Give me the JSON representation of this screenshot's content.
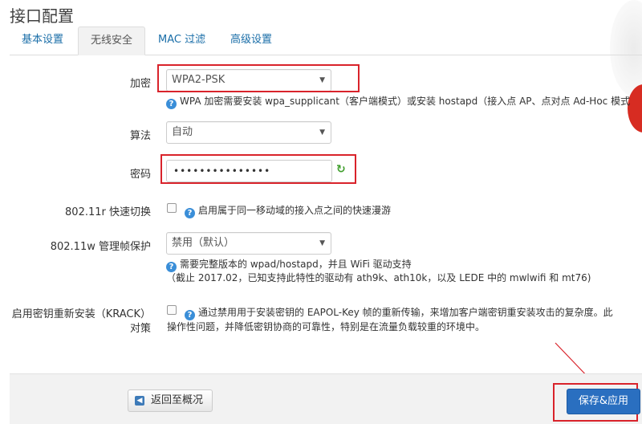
{
  "page": {
    "title": "接口配置"
  },
  "tabs": [
    {
      "label": "基本设置",
      "active": false
    },
    {
      "label": "无线安全",
      "active": true
    },
    {
      "label": "MAC 过滤",
      "active": false
    },
    {
      "label": "高级设置",
      "active": false
    }
  ],
  "form": {
    "encryption": {
      "label": "加密",
      "value": "WPA2-PSK",
      "hint": "WPA 加密需要安装 wpa_supplicant（客户端模式）或安装 hostapd（接入点 AP、点对点 Ad-Hoc 模式"
    },
    "algorithm": {
      "label": "算法",
      "value": "自动"
    },
    "password": {
      "label": "密码",
      "value": "•••••••••••••••"
    },
    "fast_roaming": {
      "label": "802.11r 快速切换",
      "checked": false,
      "description": "启用属于同一移动域的接入点之间的快速漫游"
    },
    "mgmt_frame": {
      "label": "802.11w 管理帧保护",
      "value": "禁用（默认）",
      "hint_line1": "需要完整版本的 wpad/hostapd，并且 WiFi 驱动支持",
      "hint_line2": "（截止 2017.02，已知支持此特性的驱动有 ath9k、ath10k，以及 LEDE 中的 mwlwifi 和 mt76)"
    },
    "krack": {
      "label_line1": "启用密钥重新安装（KRACK）",
      "label_line2": "对策",
      "checked": false,
      "description_line1": "通过禁用用于安装密钥的 EAPOL-Key 帧的重新传输，来增加客户端密钥重安装攻击的复杂度。此",
      "description_line2": "操作性问题，并降低密钥协商的可靠性，特别是在流量负载较重的环境中。"
    }
  },
  "footer": {
    "back_label": "返回至概况",
    "save_label": "保存&应用"
  },
  "icons": {
    "help": "help-circle-icon",
    "refresh": "refresh-icon",
    "back": "back-arrow-icon"
  },
  "colors": {
    "annotation": "#d9232b",
    "primary": "#2a6fc0",
    "link": "#1a6ea8"
  }
}
